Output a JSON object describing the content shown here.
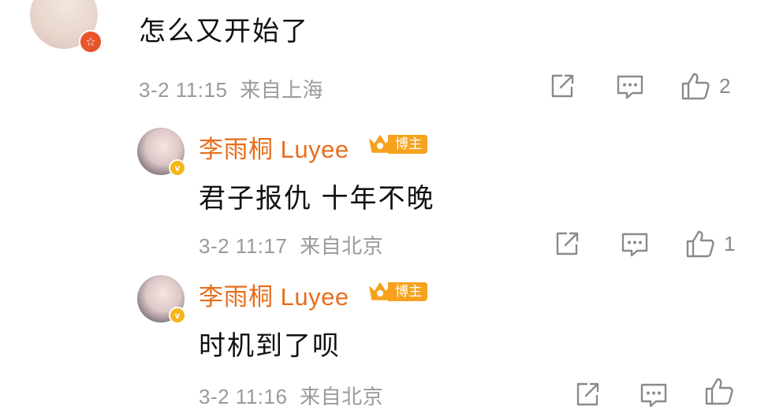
{
  "comment": {
    "text": "怎么又开始了",
    "time": "3-2 11:15",
    "location": "来自上海",
    "likes": "2",
    "avatar_badge_icon": "star-badge-icon"
  },
  "replies": [
    {
      "username": "李雨桐 Luyee",
      "tag": "博主",
      "text": "君子报仇 十年不晚",
      "time": "3-2 11:17",
      "location": "来自北京",
      "likes": "1"
    },
    {
      "username": "李雨桐 Luyee",
      "tag": "博主",
      "text": "时机到了呗",
      "time": "3-2 11:16",
      "location": "来自北京",
      "likes": ""
    }
  ],
  "colors": {
    "username": "#e86e1c",
    "tag_bg": "#f6a21e",
    "meta": "#9a9a9a",
    "icon": "#8a8a8a"
  }
}
